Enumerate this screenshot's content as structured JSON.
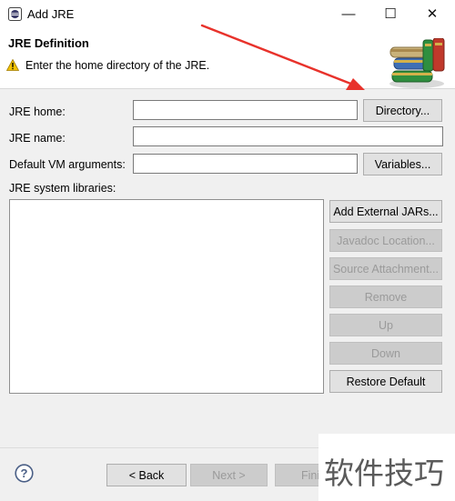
{
  "window": {
    "title": "Add JRE",
    "controls": {
      "minimize": "—",
      "maximize": "☐",
      "close": "✕"
    }
  },
  "header": {
    "title": "JRE Definition",
    "message": "Enter the home directory of the JRE.",
    "icon": "books-icon"
  },
  "form": {
    "jre_home_label": "JRE home:",
    "jre_home_value": "",
    "directory_button": "Directory...",
    "jre_name_label": "JRE name:",
    "jre_name_value": "",
    "vm_args_label": "Default VM arguments:",
    "vm_args_value": "",
    "variables_button": "Variables...",
    "libraries_label": "JRE system libraries:"
  },
  "library_buttons": {
    "add_external_jars": "Add External JARs...",
    "javadoc_location": "Javadoc Location...",
    "source_attachment": "Source Attachment...",
    "remove": "Remove",
    "up": "Up",
    "down": "Down",
    "restore_default": "Restore Default"
  },
  "footer": {
    "back_button": "< Back",
    "next_button": "Next >",
    "finish_button": "Fini"
  },
  "watermark": "软件技巧",
  "colors": {
    "annotation_arrow": "#e8322b",
    "warning": "#f2c200"
  }
}
